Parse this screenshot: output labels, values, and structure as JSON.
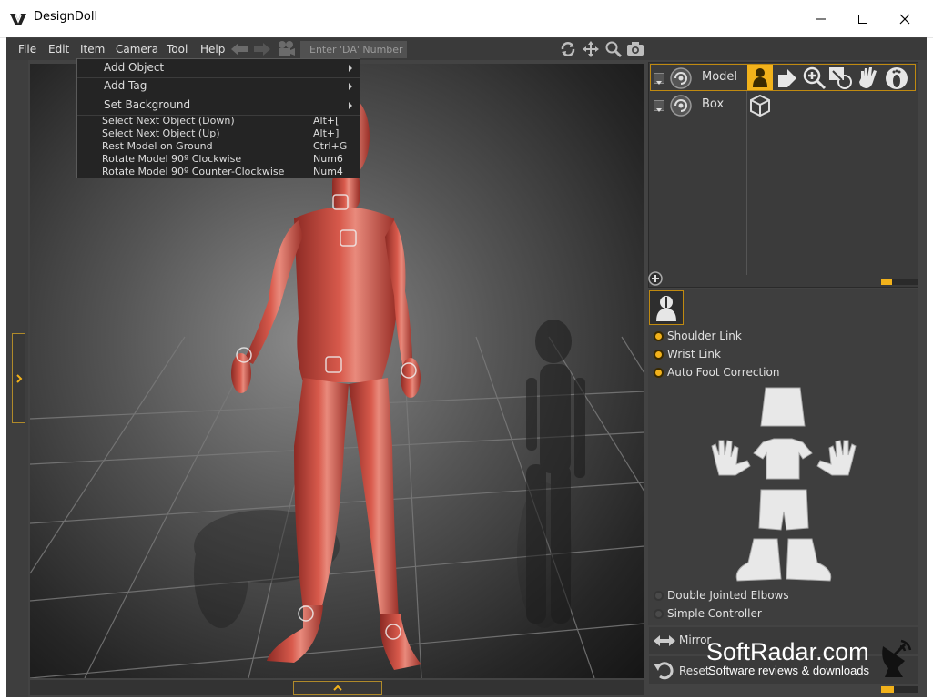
{
  "window": {
    "title": "DesignDoll",
    "controls": [
      "minimize-icon",
      "maximize-icon",
      "close-icon"
    ]
  },
  "menubar": {
    "items": [
      "File",
      "Edit",
      "Item",
      "Camera",
      "Tool",
      "Help"
    ],
    "toolbar_icons": [
      "arrow-left-icon",
      "arrow-right-icon",
      "movie-camera-icon"
    ],
    "da_number_placeholder": "Enter 'DA' Number",
    "view_icons": [
      "rotate-view-icon",
      "pan-view-icon",
      "zoom-view-icon",
      "screenshot-camera-icon"
    ]
  },
  "item_menu": {
    "submenus": [
      {
        "label": "Add Object"
      },
      {
        "label": "Add Tag"
      },
      {
        "label": "Set Background"
      }
    ],
    "commands": [
      {
        "label": "Select Next Object (Down)",
        "shortcut": "Alt+["
      },
      {
        "label": "Select Next Object (Up)",
        "shortcut": "Alt+]"
      },
      {
        "label": "Rest Model on Ground",
        "shortcut": "Ctrl+G"
      },
      {
        "label": "Rotate Model 90º Clockwise",
        "shortcut": "Num6"
      },
      {
        "label": "Rotate Model 90º Counter-Clockwise",
        "shortcut": "Num4"
      }
    ]
  },
  "scene_tree": {
    "items": [
      {
        "label": "Model",
        "selected": true,
        "tools": [
          "body-select-icon",
          "pose-tool-icon",
          "zoom-in-icon",
          "move-to-icon",
          "hand-icon",
          "foot-icon"
        ]
      },
      {
        "label": "Box",
        "selected": false,
        "tools": [
          "cube-icon"
        ]
      }
    ],
    "add_icon": "add-icon"
  },
  "properties": {
    "top_options": [
      {
        "label": "Shoulder Link",
        "on": true
      },
      {
        "label": "Wrist Link",
        "on": true
      },
      {
        "label": "Auto Foot Correction",
        "on": true
      }
    ],
    "bottom_options": [
      {
        "label": "Double Jointed Elbows",
        "on": false
      },
      {
        "label": "Simple Controller",
        "on": false
      }
    ],
    "mirror_label": "Mirror",
    "reset_label": "Reset"
  },
  "watermark": {
    "title": "SoftRadar.com",
    "subtitle": "Software reviews & downloads"
  },
  "colors": {
    "accent": "#f2b21b",
    "panel": "#3b3b3b",
    "doll": "#c8493e"
  }
}
